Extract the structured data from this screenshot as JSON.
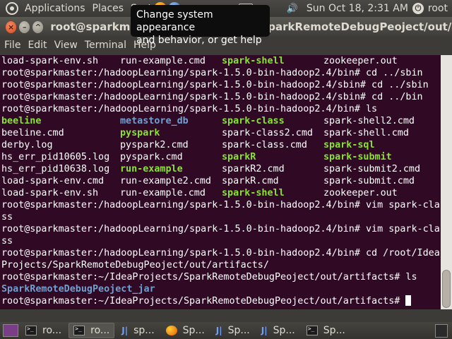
{
  "top_panel": {
    "menus": [
      "Applications",
      "Places",
      "System"
    ],
    "clock": "Sun Oct 18,  2:31 AM",
    "user": "root",
    "colors": {
      "panel": "#3c3b37",
      "text": "#dfdbd2"
    }
  },
  "tooltip": {
    "line1": "Change system appearance",
    "line2": "and behavior, or get help"
  },
  "window": {
    "title": "root@sparkmaster: ~/IdeaProjects/SparkRemoteDebugPeoject/out/artifacts",
    "menu": [
      "File",
      "Edit",
      "View",
      "Terminal",
      "Help"
    ]
  },
  "terminal": {
    "bg": "#300a24",
    "lines": [
      {
        "type": "cols",
        "cells": [
          {
            "t": "load-spark-env.sh",
            "s": ""
          },
          {
            "t": "run-example.cmd",
            "s": ""
          },
          {
            "t": "spark-shell",
            "s": "exec"
          },
          {
            "t": "zookeeper.out",
            "s": ""
          }
        ]
      },
      {
        "type": "text",
        "text": "root@sparkmaster:/hadoopLearning/spark-1.5.0-bin-hadoop2.4/bin# cd ../sbin"
      },
      {
        "type": "text",
        "text": "root@sparkmaster:/hadoopLearning/spark-1.5.0-bin-hadoop2.4/sbin# cd ../sbin"
      },
      {
        "type": "text",
        "text": "root@sparkmaster:/hadoopLearning/spark-1.5.0-bin-hadoop2.4/sbin# cd ../bin"
      },
      {
        "type": "text",
        "text": "root@sparkmaster:/hadoopLearning/spark-1.5.0-bin-hadoop2.4/bin# ls"
      },
      {
        "type": "cols",
        "cells": [
          {
            "t": "beeline",
            "s": "exec"
          },
          {
            "t": "metastore_db",
            "s": "dir"
          },
          {
            "t": "spark-class",
            "s": "exec"
          },
          {
            "t": "spark-shell2.cmd",
            "s": ""
          }
        ]
      },
      {
        "type": "cols",
        "cells": [
          {
            "t": "beeline.cmd",
            "s": ""
          },
          {
            "t": "pyspark",
            "s": "exec"
          },
          {
            "t": "spark-class2.cmd",
            "s": ""
          },
          {
            "t": "spark-shell.cmd",
            "s": ""
          }
        ]
      },
      {
        "type": "cols",
        "cells": [
          {
            "t": "derby.log",
            "s": ""
          },
          {
            "t": "pyspark2.cmd",
            "s": ""
          },
          {
            "t": "spark-class.cmd",
            "s": ""
          },
          {
            "t": "spark-sql",
            "s": "exec"
          }
        ]
      },
      {
        "type": "cols",
        "cells": [
          {
            "t": "hs_err_pid10605.log",
            "s": ""
          },
          {
            "t": "pyspark.cmd",
            "s": ""
          },
          {
            "t": "sparkR",
            "s": "exec"
          },
          {
            "t": "spark-submit",
            "s": "exec"
          }
        ]
      },
      {
        "type": "cols",
        "cells": [
          {
            "t": "hs_err_pid10638.log",
            "s": ""
          },
          {
            "t": "run-example",
            "s": "exec"
          },
          {
            "t": "sparkR2.cmd",
            "s": ""
          },
          {
            "t": "spark-submit2.cmd",
            "s": ""
          }
        ]
      },
      {
        "type": "cols",
        "cells": [
          {
            "t": "load-spark-env.cmd",
            "s": ""
          },
          {
            "t": "run-example2.cmd",
            "s": ""
          },
          {
            "t": "sparkR.cmd",
            "s": ""
          },
          {
            "t": "spark-submit.cmd",
            "s": ""
          }
        ]
      },
      {
        "type": "cols",
        "cells": [
          {
            "t": "load-spark-env.sh",
            "s": ""
          },
          {
            "t": "run-example.cmd",
            "s": ""
          },
          {
            "t": "spark-shell",
            "s": "exec"
          },
          {
            "t": "zookeeper.out",
            "s": ""
          }
        ]
      },
      {
        "type": "text",
        "text": "root@sparkmaster:/hadoopLearning/spark-1.5.0-bin-hadoop2.4/bin# vim spark-cla"
      },
      {
        "type": "text",
        "text": "ss"
      },
      {
        "type": "text",
        "text": "root@sparkmaster:/hadoopLearning/spark-1.5.0-bin-hadoop2.4/bin# vim spark-cla"
      },
      {
        "type": "text",
        "text": "ss"
      },
      {
        "type": "text",
        "text": "root@sparkmaster:/hadoopLearning/spark-1.5.0-bin-hadoop2.4/bin# cd /root/Idea"
      },
      {
        "type": "text",
        "text": "Projects/SparkRemoteDebugPeoject/out/artifacts/"
      },
      {
        "type": "text",
        "text": "root@sparkmaster:~/IdeaProjects/SparkRemoteDebugPeoject/out/artifacts# ls"
      },
      {
        "type": "text",
        "text": "SparkRemoteDebugPeoject_jar",
        "s": "dir"
      },
      {
        "type": "prompt",
        "text": "root@sparkmaster:~/IdeaProjects/SparkRemoteDebugPeoject/out/artifacts# "
      }
    ]
  },
  "taskbar": {
    "tasks": [
      {
        "label": "ro...",
        "icon": "terminal-icon",
        "active": false
      },
      {
        "label": "ro...",
        "icon": "terminal-icon",
        "active": true
      },
      {
        "label": "sp...",
        "icon": "intellij-icon",
        "active": false
      },
      {
        "label": "Sp...",
        "icon": "firefox-icon",
        "active": false
      },
      {
        "label": "Sp...",
        "icon": "intellij-icon",
        "active": false
      },
      {
        "label": "Sp...",
        "icon": "intellij-icon",
        "active": false
      },
      {
        "label": "Sp...",
        "icon": "terminal-icon",
        "active": false
      }
    ]
  }
}
